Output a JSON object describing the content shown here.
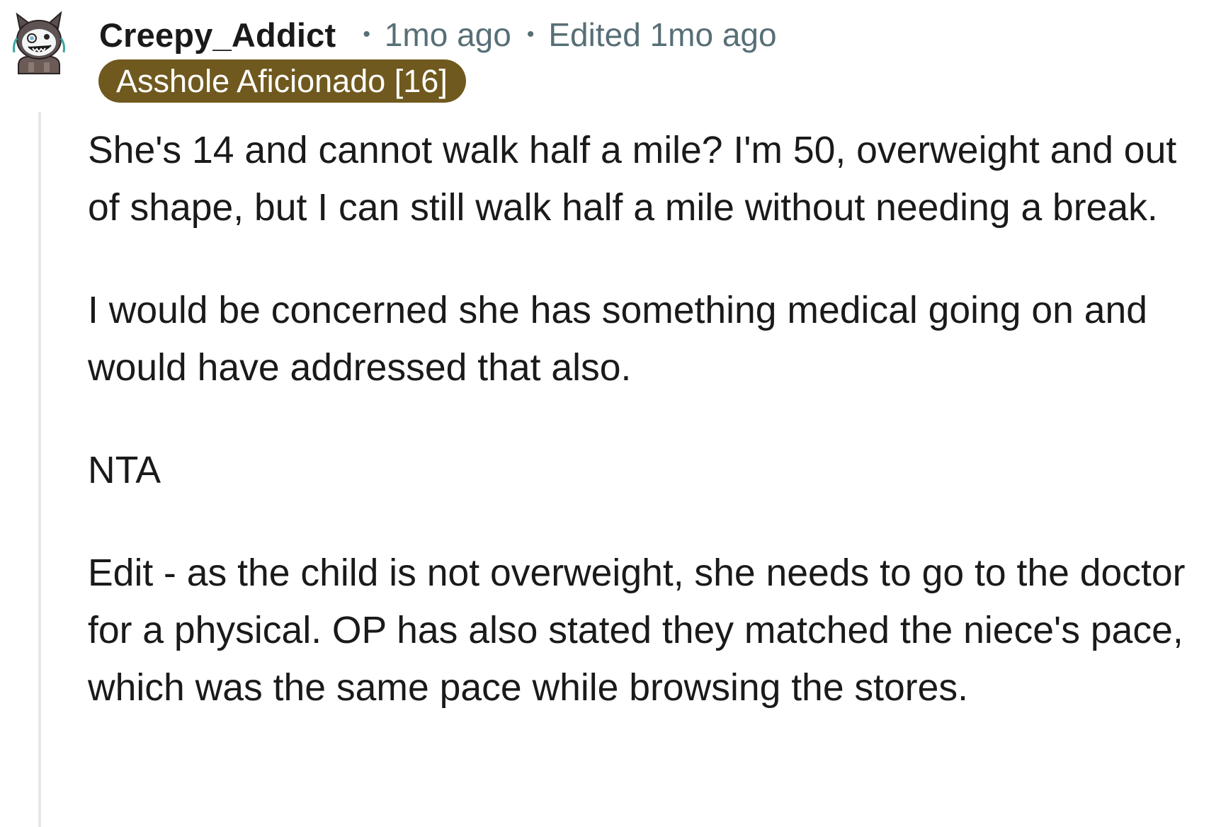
{
  "comment": {
    "author": "Creepy_Addict",
    "posted": "1mo ago",
    "edited": "Edited 1mo ago",
    "separator": "•",
    "flair": "Asshole Aficionado [16]",
    "paragraphs": [
      "She's 14 and cannot walk half a mile? I'm 50, overweight and out of shape, but I can still walk half a mile without needing a break.",
      "I would be concerned she has something medical going on and would have addressed that also.",
      "NTA",
      "Edit - as the child is not overweight, she needs to go to the doctor for a physical. OP has also stated they matched the niece's pace, which was the same pace while browsing the stores."
    ]
  },
  "colors": {
    "flair_background": "#70591e",
    "flair_text": "#ffffff",
    "meta_text": "#576f76",
    "body_text": "#1a1a1b",
    "thread_line": "#e5e7e9"
  },
  "icons": {
    "avatar": "snoo-avatar-icon"
  }
}
